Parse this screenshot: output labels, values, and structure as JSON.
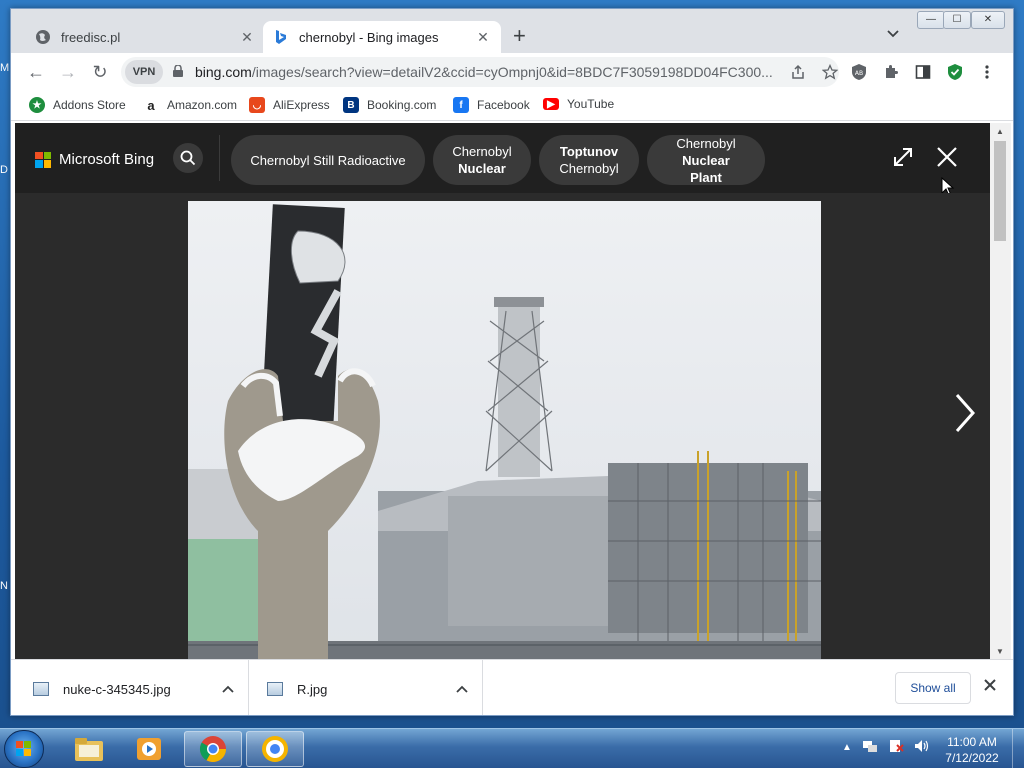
{
  "window": {
    "tabs": [
      {
        "title": "freedisc.pl",
        "close": "✕"
      },
      {
        "title": "chernobyl - Bing images",
        "close": "✕"
      }
    ],
    "new_tab": "+",
    "tab_search": "⌄",
    "controls": {
      "minimize": "—",
      "maximize": "☐",
      "close": "✕"
    }
  },
  "toolbar": {
    "back": "←",
    "forward": "→",
    "reload": "↻",
    "vpn_label": "VPN",
    "url_host": "bing.com",
    "url_rest": "/images/search?view=detailV2&ccid=cyOmpnj0&id=8BDC7F3059198DD04FC300..."
  },
  "bookmarks": [
    {
      "label": "Addons Store",
      "icon": "addons-store-icon",
      "color": "#1e8e3e"
    },
    {
      "label": "Amazon.com",
      "icon": "amazon-icon",
      "color": "#222222"
    },
    {
      "label": "AliExpress",
      "icon": "aliexpress-icon",
      "color": "#e8481c"
    },
    {
      "label": "Booking.com",
      "icon": "booking-icon",
      "color": "#003580"
    },
    {
      "label": "Facebook",
      "icon": "facebook-icon",
      "color": "#1877f2"
    },
    {
      "label": "YouTube",
      "icon": "youtube-icon",
      "color": "#ff0000"
    }
  ],
  "bing": {
    "logo_text": "Microsoft Bing",
    "related": [
      {
        "line1": "Chernobyl Still Radioactive",
        "line2": ""
      },
      {
        "line1": "Chernobyl",
        "line2": "Nuclear"
      },
      {
        "line1": "Toptunov",
        "line2": "Chernobyl"
      },
      {
        "line1": "Chernobyl",
        "line2": "Nuclear Plant"
      }
    ]
  },
  "downloads": {
    "items": [
      {
        "filename": "nuke-c-345345.jpg"
      },
      {
        "filename": "R.jpg"
      }
    ],
    "show_all": "Show all"
  },
  "taskbar": {
    "time": "11:00 AM",
    "date": "7/12/2022"
  },
  "colors": {
    "bing_bg": "#202020",
    "pill_bg": "#3a3a3a",
    "accent": "#1a73e8"
  }
}
